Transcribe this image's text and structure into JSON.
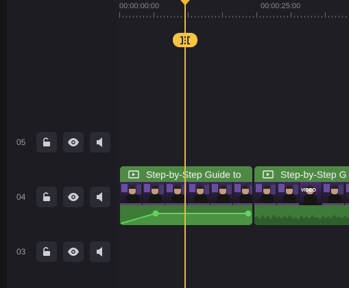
{
  "ruler": {
    "time_labels": [
      "00:00:00:00",
      "00:00:25:00"
    ]
  },
  "tracks": [
    {
      "label": "05",
      "has_clip": false
    },
    {
      "label": "04",
      "has_clip": true
    },
    {
      "label": "03",
      "has_clip": false
    }
  ],
  "track_buttons": {
    "lock_icon": "unlock-icon",
    "visibility_icon": "eye-icon",
    "audio_icon": "speaker-icon"
  },
  "clips": [
    {
      "title": "Step-by-Step Guide to",
      "thumb_icon": "film-icon"
    },
    {
      "title": "Step-by-Step G",
      "thumb_icon": "film-icon",
      "thumb_badge": "VIDEO"
    }
  ],
  "playhead": {
    "split_icon": "split-icon"
  },
  "colors": {
    "playhead": "#f5b82e",
    "clip_header": "#4f8a45",
    "clip_body": "#3d7a3b",
    "audio_line": "#5fd45a",
    "background": "#1e1e24"
  }
}
